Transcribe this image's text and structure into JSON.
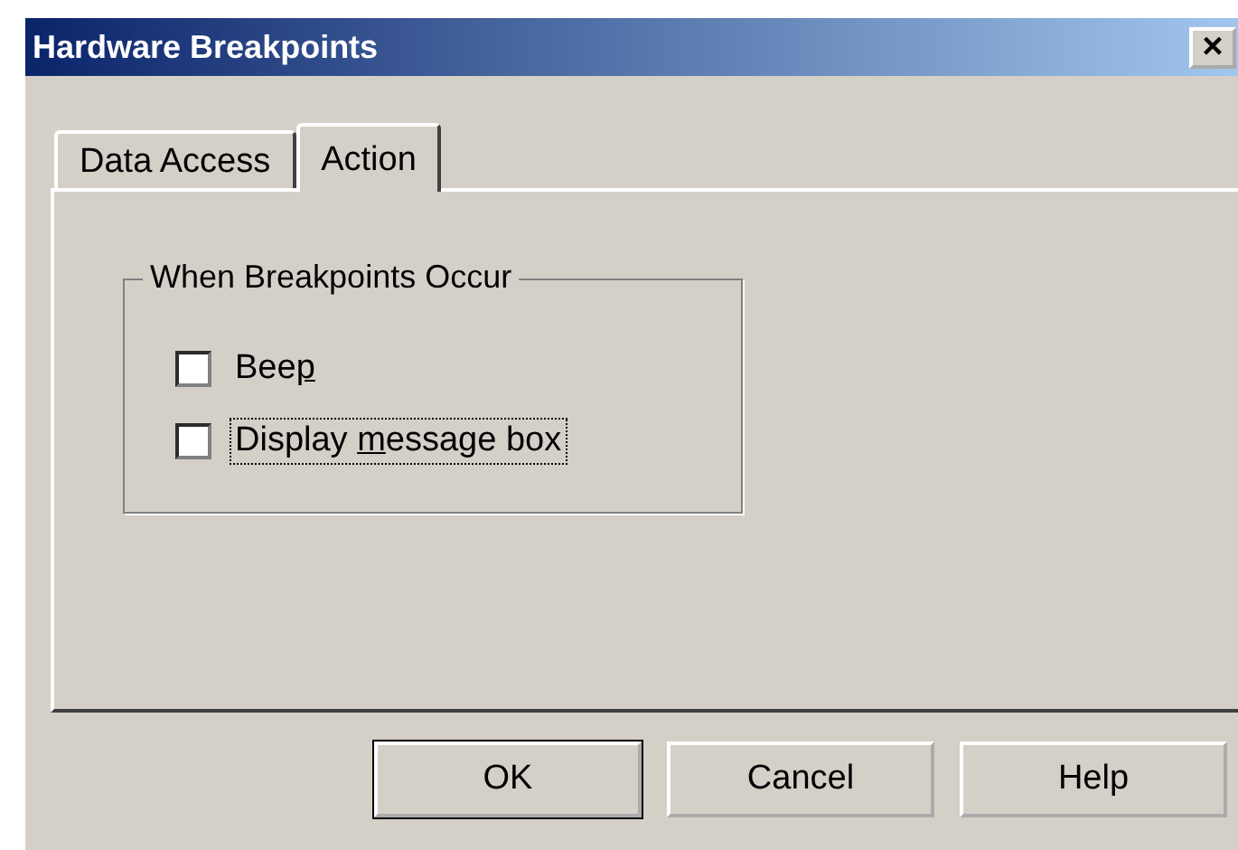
{
  "window": {
    "title": "Hardware Breakpoints",
    "close": "×"
  },
  "tabs": [
    {
      "label": "Data Access",
      "selected": false
    },
    {
      "label": "Action",
      "selected": true
    }
  ],
  "group": {
    "title": "When Breakpoints Occur",
    "options": [
      {
        "text_before": "Bee",
        "mnemonic": "p",
        "checked": false,
        "focused": false
      },
      {
        "text_before": "Display ",
        "mnemonic": "m",
        "text_after": "essage box",
        "checked": false,
        "focused": true
      }
    ]
  },
  "buttons": [
    {
      "label": "OK",
      "default": true
    },
    {
      "label": "Cancel",
      "default": false
    },
    {
      "label": "Help",
      "default": false
    }
  ]
}
